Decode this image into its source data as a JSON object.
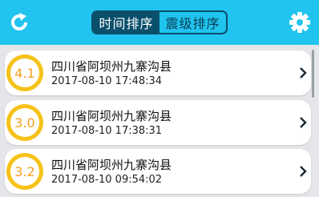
{
  "header": {
    "background": "#20c4ef",
    "refresh_icon": "refresh-icon",
    "settings_icon": "gear-icon",
    "tabs": [
      {
        "label": "时间排序",
        "active": true
      },
      {
        "label": "震级排序",
        "active": false
      }
    ]
  },
  "quakes": [
    {
      "magnitude": "4.1",
      "location": "四川省阿坝州九寨沟县",
      "time": "2017-08-10 17:48:34"
    },
    {
      "magnitude": "3.0",
      "location": "四川省阿坝州九寨沟县",
      "time": "2017-08-10 17:38:31"
    },
    {
      "magnitude": "3.2",
      "location": "四川省阿坝州九寨沟县",
      "time": "2017-08-10 09:54:02"
    }
  ],
  "colors": {
    "badge_ring": "#f6c21a",
    "badge_text": "#f5a01c",
    "segment": "#0a4f6b"
  }
}
